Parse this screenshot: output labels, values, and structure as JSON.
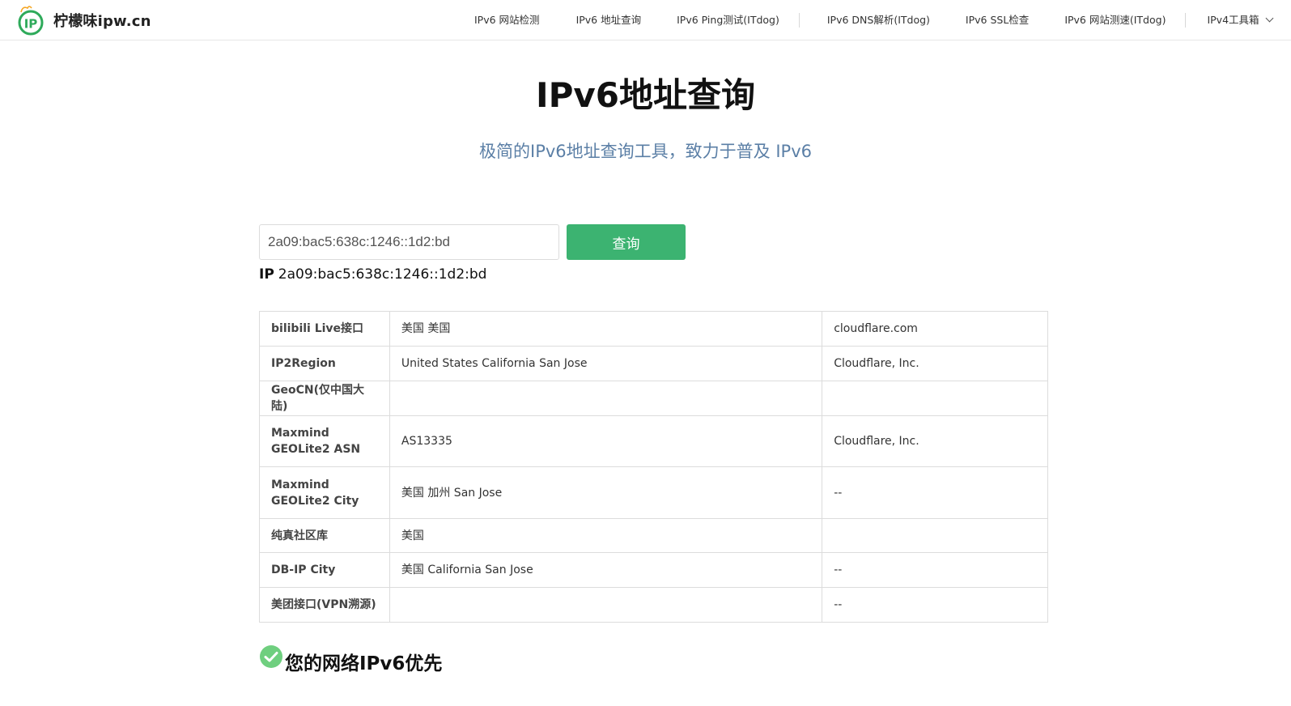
{
  "header": {
    "logo_text": "IP",
    "brand": "柠檬味ipw.cn",
    "nav": [
      {
        "label": "IPv6 网站检测"
      },
      {
        "label": "IPv6 地址查询"
      },
      {
        "label": "IPv6 Ping测试(ITdog)"
      },
      {
        "label": "IPv6 DNS解析(ITdog)"
      },
      {
        "label": "IPv6 SSL检查"
      },
      {
        "label": "IPv6 网站测速(ITdog)"
      },
      {
        "label": "IPv4工具箱"
      }
    ]
  },
  "main": {
    "title": "IPv6地址查询",
    "subtitle": "极简的IPv6地址查询工具，致力于普及 IPv6",
    "search": {
      "value": "2a09:bac5:638c:1246::1d2:bd",
      "button": "查询"
    },
    "ip_result": {
      "label": "IP",
      "value": "2a09:bac5:638c:1246::1d2:bd"
    },
    "table": {
      "rows": [
        {
          "source": "bilibili Live接口",
          "location": "美国 美国",
          "org": "cloudflare.com"
        },
        {
          "source": "IP2Region",
          "location": "United States California San Jose",
          "org": "Cloudflare, Inc."
        },
        {
          "source": "GeoCN(仅中国大陆)",
          "location": "",
          "org": ""
        },
        {
          "source": "Maxmind GEOLite2 ASN",
          "location": "AS13335",
          "org": "Cloudflare, Inc."
        },
        {
          "source": "Maxmind GEOLite2 City",
          "location": "美国 加州 San Jose",
          "org": "--"
        },
        {
          "source": "纯真社区库",
          "location": "美国",
          "org": ""
        },
        {
          "source": "DB-IP City",
          "location": "美国 California San Jose",
          "org": "--"
        },
        {
          "source": "美团接口(VPN溯源)",
          "location": "",
          "org": "--"
        }
      ]
    },
    "status": {
      "text": "您的网络IPv6优先",
      "icon": "check-circle-icon",
      "color": "#6fcf7f"
    }
  },
  "colors": {
    "accent": "#3cb371",
    "subtitle": "#5b7fa6",
    "logo": "#2eaa5a"
  }
}
